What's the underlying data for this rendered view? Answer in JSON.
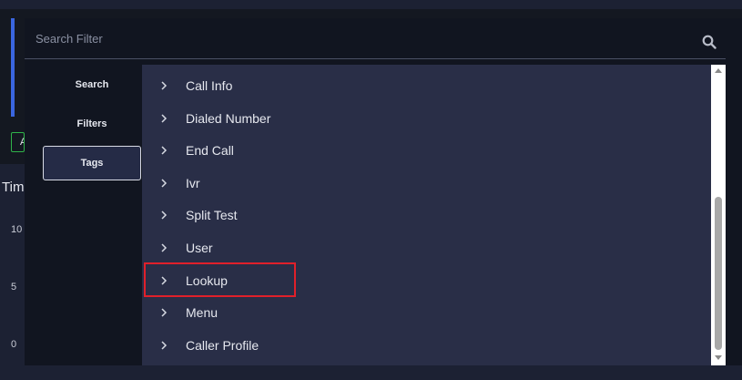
{
  "background": {
    "chip_text": "A",
    "title": "Tim",
    "axis_labels": [
      "10",
      "5",
      "0"
    ]
  },
  "search": {
    "placeholder": "Search Filter",
    "value": "",
    "icon": "search-icon"
  },
  "nav": {
    "items": [
      {
        "label": "Search",
        "selected": false
      },
      {
        "label": "Filters",
        "selected": false
      },
      {
        "label": "Tags",
        "selected": true
      }
    ]
  },
  "tags": {
    "items": [
      {
        "label": "Call Info"
      },
      {
        "label": "Dialed Number"
      },
      {
        "label": "End Call"
      },
      {
        "label": "Ivr"
      },
      {
        "label": "Split Test"
      },
      {
        "label": "User"
      },
      {
        "label": "Lookup",
        "highlighted": true
      },
      {
        "label": "Menu"
      },
      {
        "label": "Caller Profile"
      }
    ],
    "expand_icon": "chevron-right-icon"
  },
  "colors": {
    "background": "#1c2133",
    "modal": "#111520",
    "list": "#292e47",
    "selected_nav": "#252b46",
    "highlight": "#e0202a",
    "accent": "#3a66e0"
  }
}
